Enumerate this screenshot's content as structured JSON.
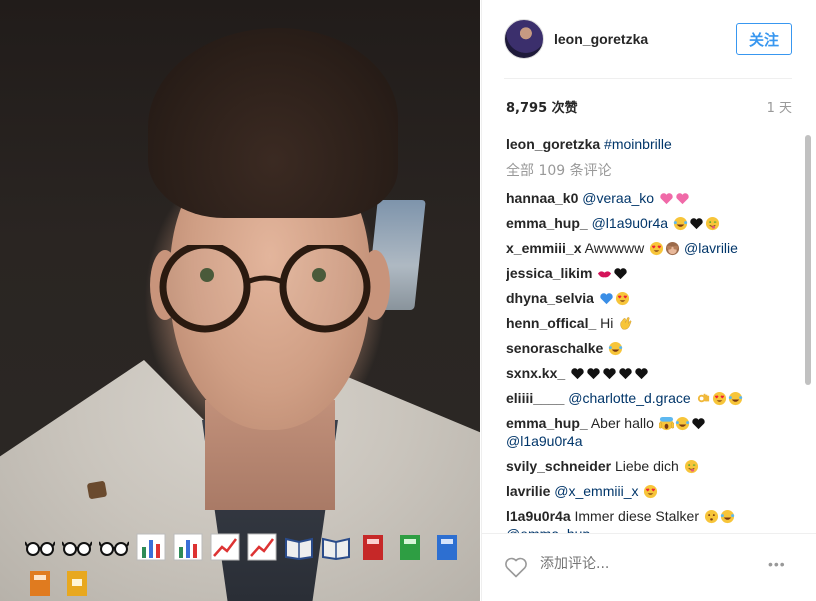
{
  "post": {
    "username": "leon_goretzka",
    "follow_label": "关注",
    "likes": "8,795 次赞",
    "time_ago": "1 天"
  },
  "caption": {
    "username": "leon_goretzka",
    "hashtag": "#moinbrille"
  },
  "view_all_comments": "全部 109 条评论",
  "comments": [
    {
      "user": "hannaa_k0",
      "text": "",
      "mention": "@veraa_ko",
      "emojis": [
        "pink-hearts",
        "pink-hearts"
      ]
    },
    {
      "user": "emma_hup_",
      "text": "",
      "mention": "@l1a9u0r4a",
      "emojis": [
        "laugh-tears",
        "black-heart",
        "wink-tongue"
      ]
    },
    {
      "user": "x_emmiii_x",
      "text": "Awwwww",
      "mention": "@lavrilie",
      "emojis": [
        "heart-eyes",
        "see-no-evil-monkey"
      ]
    },
    {
      "user": "jessica_likim",
      "text": "",
      "mention": "",
      "emojis": [
        "kiss-lips",
        "black-heart"
      ]
    },
    {
      "user": "dhyna_selvia",
      "text": "",
      "mention": "",
      "emojis": [
        "blue-heart",
        "heart-eyes"
      ]
    },
    {
      "user": "henn_offical_",
      "text": "Hi",
      "mention": "",
      "emojis": [
        "waving-hand"
      ]
    },
    {
      "user": "senoraschalke",
      "text": "",
      "mention": "",
      "emojis": [
        "laugh-tears"
      ]
    },
    {
      "user": "sxnx.kx_",
      "text": "",
      "mention": "",
      "emojis": [
        "black-heart",
        "black-heart",
        "black-heart",
        "black-heart",
        "black-heart"
      ]
    },
    {
      "user": "eliiii____",
      "text": "",
      "mention": "@charlotte_d.grace",
      "emojis": [
        "ok-hand",
        "heart-eyes",
        "laugh-tears"
      ]
    },
    {
      "user": "emma_hup_",
      "text": "Aber hallo",
      "mention": "@l1a9u0r4a",
      "emojis": [
        "scream-face",
        "laugh-tears",
        "black-heart"
      ]
    },
    {
      "user": "svily_schneider",
      "text": "Liebe dich",
      "mention": "",
      "emojis": [
        "wink-tongue"
      ]
    },
    {
      "user": "lavrilie",
      "text": "",
      "mention": "@x_emmiii_x",
      "emojis": [
        "heart-eyes"
      ]
    },
    {
      "user": "l1a9u0r4a",
      "text": "Immer diese Stalker",
      "mention": "@emma_hup_",
      "emojis": [
        "kiss-face",
        "laugh-tears"
      ]
    }
  ],
  "comment_input": {
    "placeholder": "添加评论..."
  },
  "more_label": "•••",
  "photo_emojis": [
    "glasses-emoji",
    "glasses-emoji",
    "glasses-emoji",
    "bar-chart-emoji",
    "bar-chart-emoji",
    "chart-up-emoji",
    "chart-up-emoji",
    "open-book-emoji",
    "open-book-emoji",
    "red-book-emoji",
    "green-book-emoji",
    "blue-book-emoji",
    "orange-book-emoji",
    "ledger-emoji"
  ],
  "colors": {
    "link": "#003569",
    "follow": "#3897f0",
    "muted": "#999999"
  }
}
